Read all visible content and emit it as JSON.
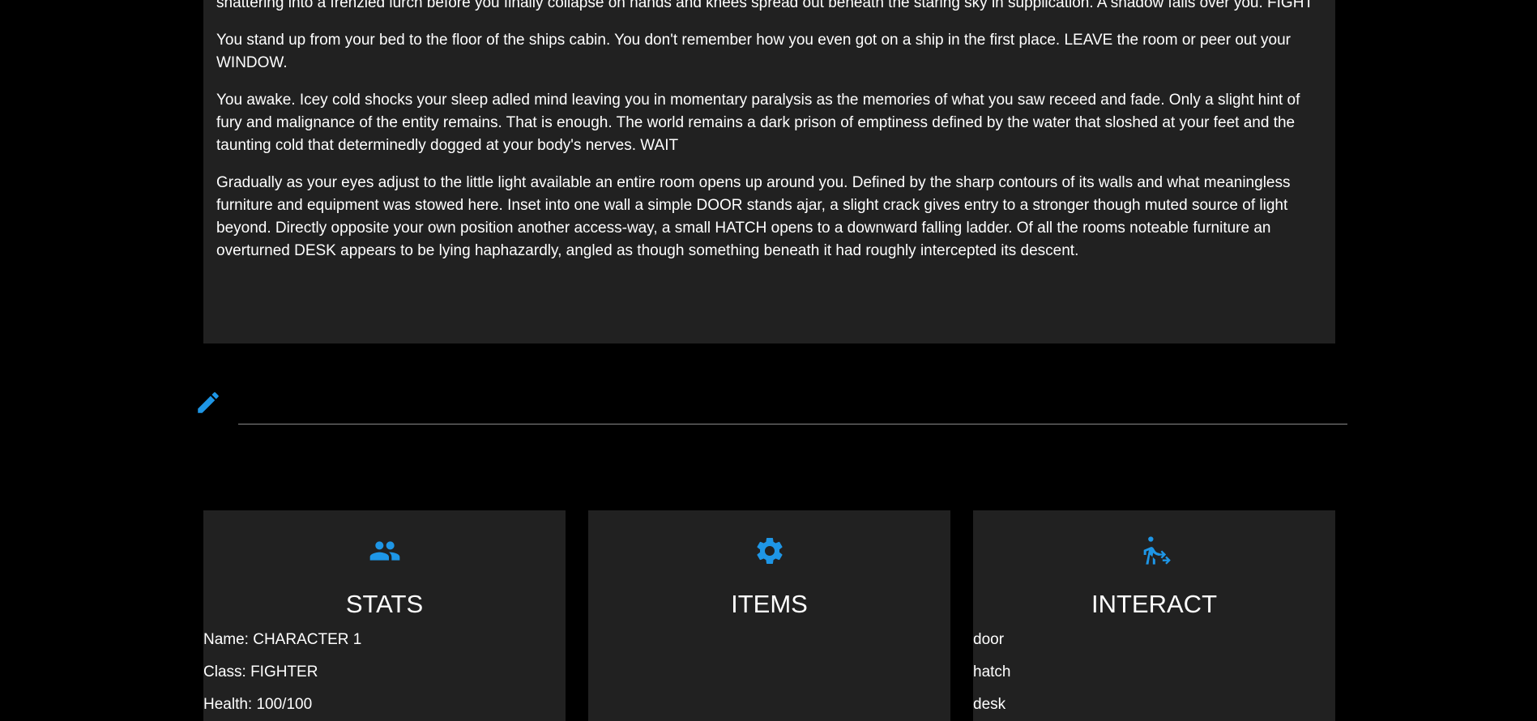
{
  "colors": {
    "background": "#000000",
    "panel": "#212121",
    "accent": "#1e96e6",
    "text": "#ffffff",
    "input_line": "#8a8a8a"
  },
  "story": {
    "paragraphs": [
      "your predicament you push yourself deeper into this beautiful nightmare. The calm gait with which you had started, shambles into a slurred sleepy wobble, and shattering into a frenzied lurch before you finally collapse on hands and knees spread out beneath the staring sky in supplication. A shadow falls over you. FIGHT",
      "You stand up from your bed to the floor of the ships cabin. You don't remember how you even got on a ship in the first place. LEAVE the room or peer out your WINDOW.",
      "You awake. Icey cold shocks your sleep adled mind leaving you in momentary paralysis as the memories of what you saw receed and fade. Only a slight hint of fury and malignance of the entity remains. That is enough. The world remains a dark prison of emptiness defined by the water that sloshed at your feet and the taunting cold that determinedly dogged at your body's nerves. WAIT",
      "Gradually as your eyes adjust to the little light available an entire room opens up around you. Defined by the sharp contours of its walls and what meaningless furniture and equipment was stowed here. Inset into one wall a simple DOOR stands ajar, a slight crack gives entry to a stronger though muted source of light beyond. Directly opposite your own position another access-way, a small HATCH opens to a downward falling ladder. Of all the rooms noteable furniture an overturned DESK appears to be lying haphazardly, angled as though something beneath it had roughly intercepted its descent."
    ]
  },
  "command_input": {
    "icon": "pencil-icon",
    "value": "",
    "placeholder": ""
  },
  "cards": {
    "stats": {
      "icon": "people-icon",
      "title": "STATS",
      "lines": [
        "Name: CHARACTER 1",
        "Class: FIGHTER",
        "Health: 100/100"
      ]
    },
    "items": {
      "icon": "gear-icon",
      "title": "ITEMS",
      "lines": []
    },
    "interact": {
      "icon": "walk-interact-icon",
      "title": "INTERACT",
      "lines": [
        "door",
        "hatch",
        "desk"
      ]
    }
  }
}
